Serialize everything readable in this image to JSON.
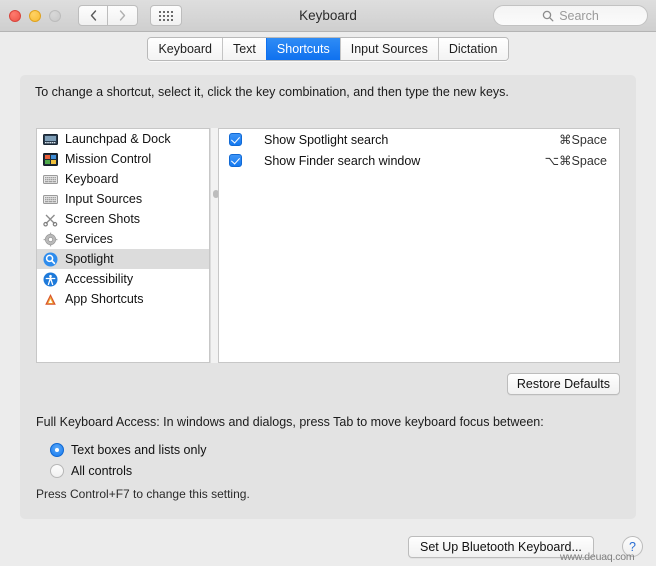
{
  "window": {
    "title": "Keyboard",
    "traffic_lights": [
      "close-red",
      "minimize-yellow",
      "zoom-gray-disabled"
    ],
    "back_icon": "chevron-left-icon",
    "forward_icon": "chevron-right-icon",
    "grid_icon": "show-all-grid-icon",
    "search": {
      "placeholder": "Search",
      "icon": "search-icon",
      "value": ""
    }
  },
  "tabs": [
    {
      "label": "Keyboard",
      "active": false
    },
    {
      "label": "Text",
      "active": false
    },
    {
      "label": "Shortcuts",
      "active": true
    },
    {
      "label": "Input Sources",
      "active": false
    },
    {
      "label": "Dictation",
      "active": false
    }
  ],
  "main": {
    "instruction": "To change a shortcut, select it, click the key combination, and then type the new keys.",
    "categories": [
      {
        "label": "Launchpad & Dock",
        "icon": "launchpad-dock-icon",
        "selected": false
      },
      {
        "label": "Mission Control",
        "icon": "mission-control-icon",
        "selected": false
      },
      {
        "label": "Keyboard",
        "icon": "keyboard-icon",
        "selected": false
      },
      {
        "label": "Input Sources",
        "icon": "input-sources-keyboard-icon",
        "selected": false
      },
      {
        "label": "Screen Shots",
        "icon": "screen-shots-scissors-icon",
        "selected": false
      },
      {
        "label": "Services",
        "icon": "services-gear-icon",
        "selected": false
      },
      {
        "label": "Spotlight",
        "icon": "spotlight-magnifier-icon",
        "selected": true
      },
      {
        "label": "Accessibility",
        "icon": "accessibility-icon",
        "selected": false
      },
      {
        "label": "App Shortcuts",
        "icon": "app-shortcuts-icon",
        "selected": false
      }
    ],
    "shortcuts": [
      {
        "checked": true,
        "name": "Show Spotlight search",
        "combo": "⌘Space"
      },
      {
        "checked": true,
        "name": "Show Finder search window",
        "combo": "⌥⌘Space"
      }
    ],
    "restore_defaults_label": "Restore Defaults",
    "full_keyboard_access_label": "Full Keyboard Access: In windows and dialogs, press Tab to move keyboard focus between:",
    "access_options": [
      {
        "label": "Text boxes and lists only",
        "selected": true
      },
      {
        "label": "All controls",
        "selected": false
      }
    ],
    "hint": "Press Control+F7 to change this setting."
  },
  "footer": {
    "bluetooth_label": "Set Up Bluetooth Keyboard...",
    "help_label": "?",
    "help_icon": "help-question-icon",
    "watermark": "www.deuaq.com"
  },
  "colors": {
    "accent_blue": "#0f71ef",
    "window_bg": "#ececec",
    "panel_bg": "#e3e3e3",
    "list_bg": "#ffffff",
    "selected_row": "#dcdcdc"
  }
}
